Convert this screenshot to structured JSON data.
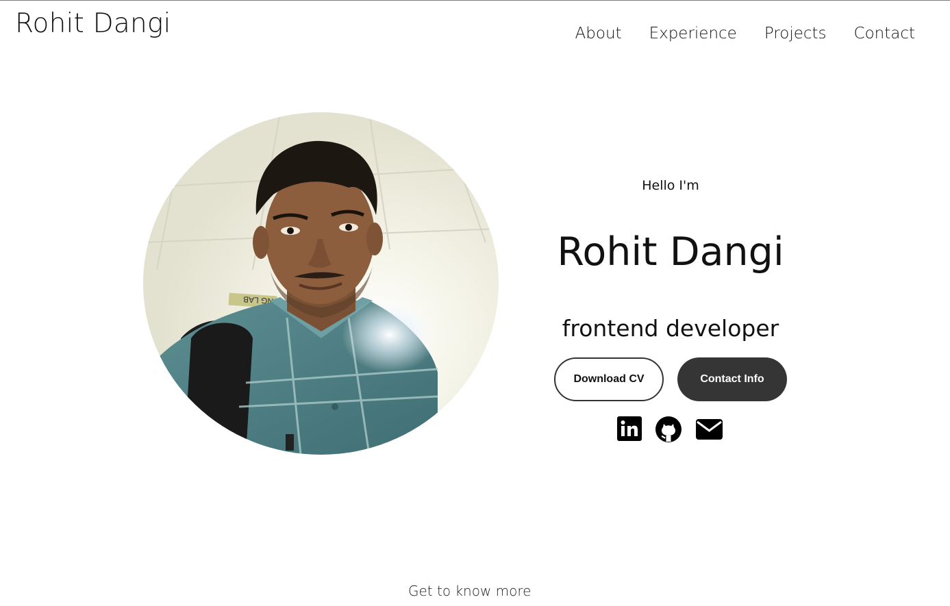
{
  "header": {
    "logo": "Rohit Dangi",
    "nav": [
      "About",
      "Experience",
      "Projects",
      "Contact"
    ]
  },
  "hero": {
    "greeting": "Hello I'm",
    "name": "Rohit Dangi",
    "role": "frontend developer",
    "buttons": {
      "download_cv": "Download CV",
      "contact_info": "Contact Info"
    },
    "socials": [
      "linkedin-icon",
      "github-icon",
      "email-icon"
    ],
    "photo_lettering": "CON... ING LAB"
  },
  "footer": {
    "cta": "Get to know more"
  },
  "colors": {
    "text": "#111111",
    "button_dark": "#353535",
    "background": "#ffffff"
  }
}
